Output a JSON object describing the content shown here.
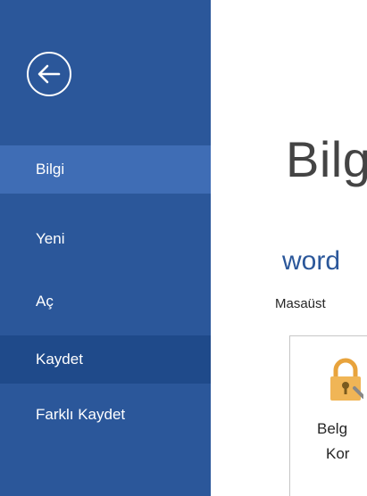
{
  "sidebar": {
    "back_icon": "back-arrow-circle-icon",
    "items": [
      {
        "label": "Bilgi",
        "state": "selected"
      },
      {
        "label": "Yeni",
        "state": "normal"
      },
      {
        "label": "Aç",
        "state": "normal"
      },
      {
        "label": "Kaydet",
        "state": "hover"
      },
      {
        "label": "Farklı Kaydet",
        "state": "normal"
      }
    ]
  },
  "main": {
    "title": "Bilg",
    "document_name": "word",
    "location": "Masaüst",
    "tile": {
      "icon": "lock-key-icon",
      "line1": "Belg",
      "line2": "Kor"
    }
  },
  "colors": {
    "sidebar_bg": "#2b579a",
    "selected_bg": "#3f6db5",
    "hover_bg": "#1f4a8a",
    "accent": "#2b579a",
    "lock_icon": "#e8a33c"
  }
}
